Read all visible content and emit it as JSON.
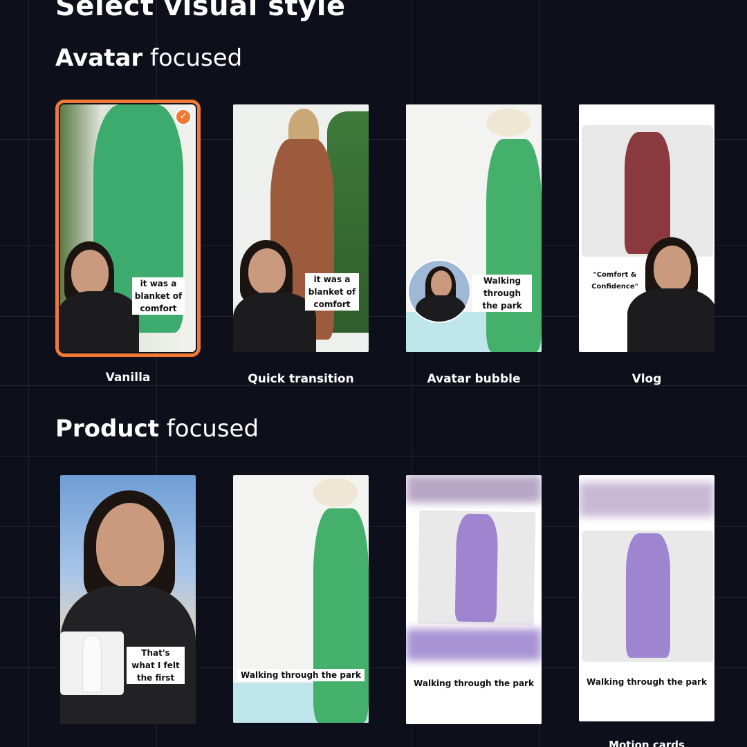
{
  "page": {
    "title": "Select visual style"
  },
  "sections": {
    "avatar": {
      "bold": "Avatar",
      "rest": " focused"
    },
    "product": {
      "bold": "Product",
      "rest": " focused"
    }
  },
  "avatar_cards": [
    {
      "label": "Vanilla",
      "caption": "it was a blanket of comfort",
      "selected": true
    },
    {
      "label": "Quick transition",
      "caption": "it was a blanket of comfort"
    },
    {
      "label": "Avatar bubble",
      "caption": "Walking through the park"
    },
    {
      "label": "Vlog",
      "caption": "\"Comfort & Confidence\""
    }
  ],
  "product_cards": [
    {
      "caption": "That's what I felt the first"
    },
    {
      "caption": "Walking through the park"
    },
    {
      "caption": "Walking through the park"
    },
    {
      "caption": "Walking through the park",
      "partial_label": "Motion cards"
    }
  ],
  "colors": {
    "background": "#0d0f1a",
    "accent": "#f07a35"
  },
  "icons": {
    "selected": "check-icon"
  }
}
